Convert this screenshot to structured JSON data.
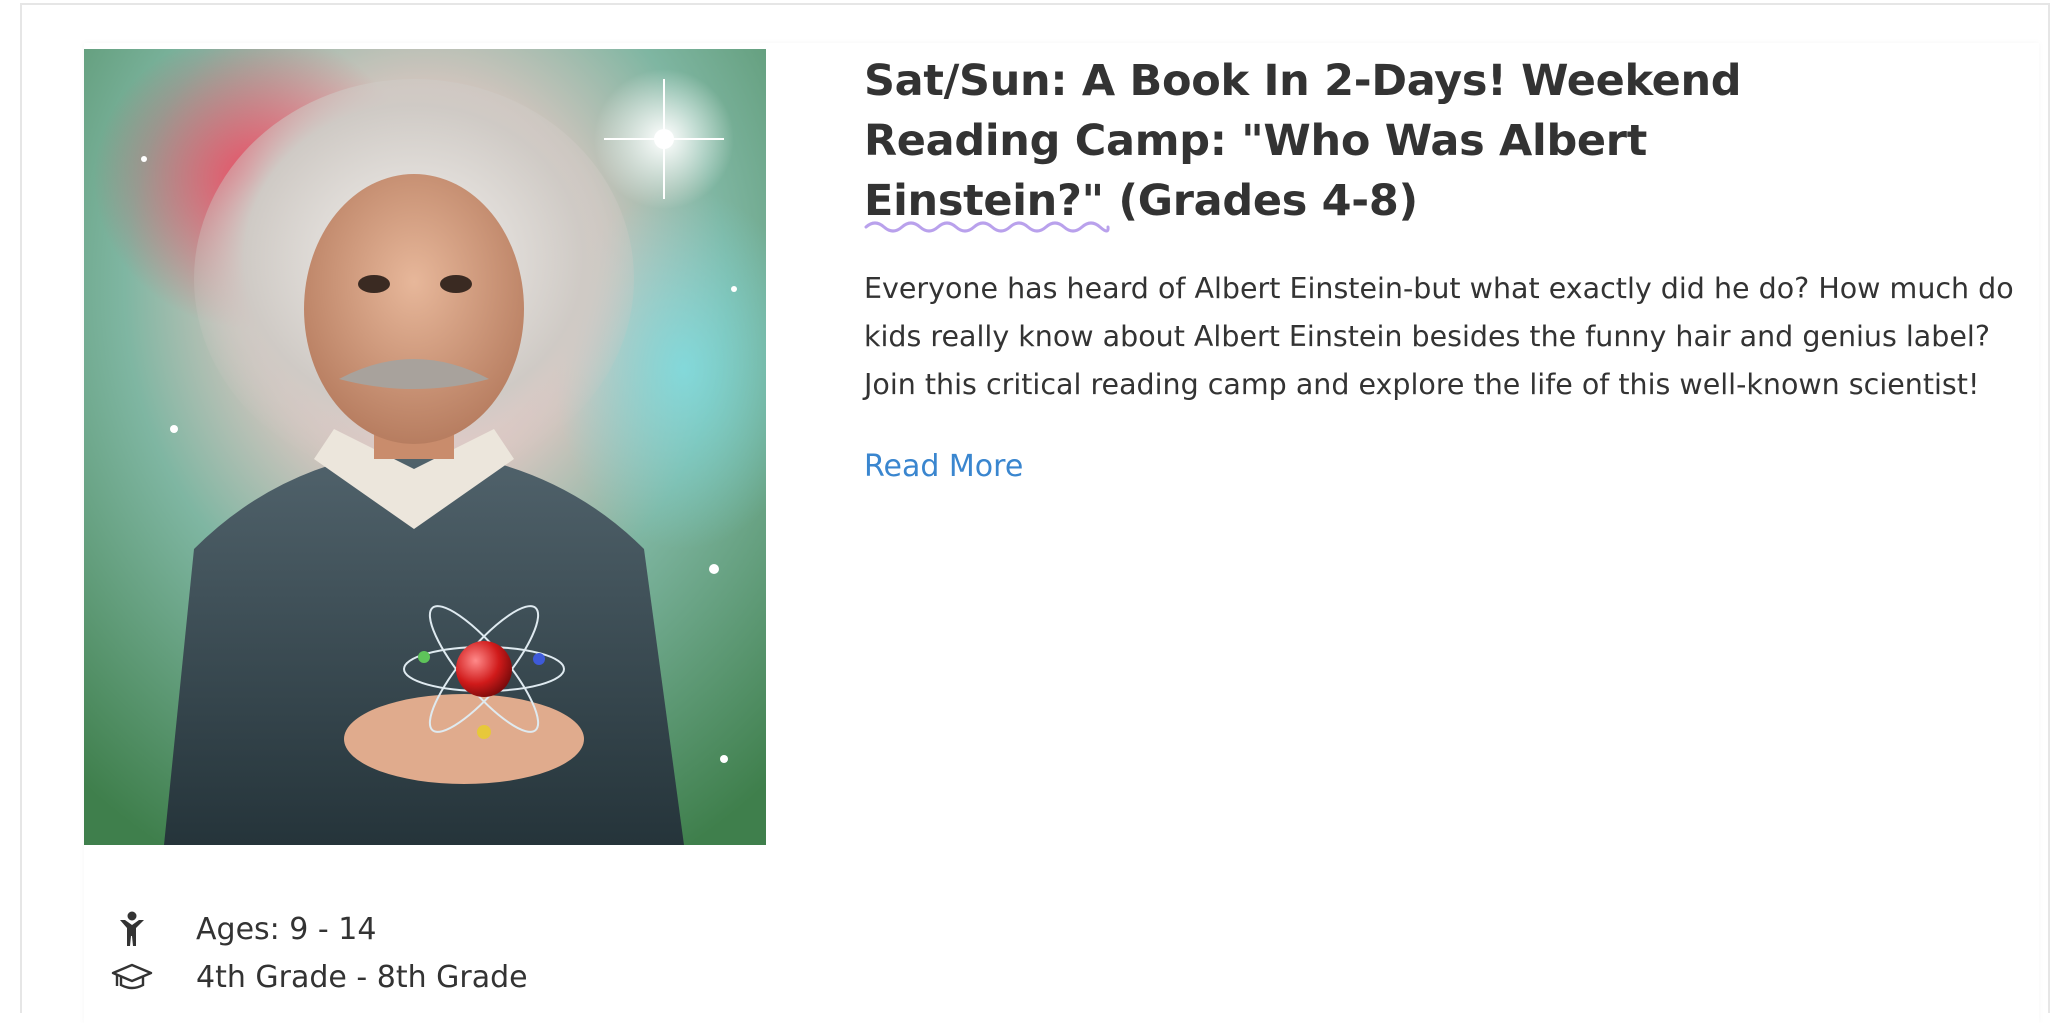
{
  "listing": {
    "title": "Sat/Sun: A Book In 2-Days! Weekend Reading Camp: \"Who Was Albert Einstein?\" (Grades 4-8)",
    "description": "Everyone has heard of Albert Einstein-but what exactly did he do? How much do kids really know about Albert Einstein besides the funny hair and genius label? Join this critical reading camp and explore the life of this well-known scientist!",
    "read_more_label": "Read More",
    "image_icon": "portrait-image",
    "accent_color": "#b9a1ec",
    "link_color": "#3a86cf"
  },
  "meta": {
    "ages": {
      "icon": "child-icon",
      "text": "Ages: 9 - 14"
    },
    "grades": {
      "icon": "graduation-cap-icon",
      "text": "4th Grade - 8th Grade"
    }
  }
}
